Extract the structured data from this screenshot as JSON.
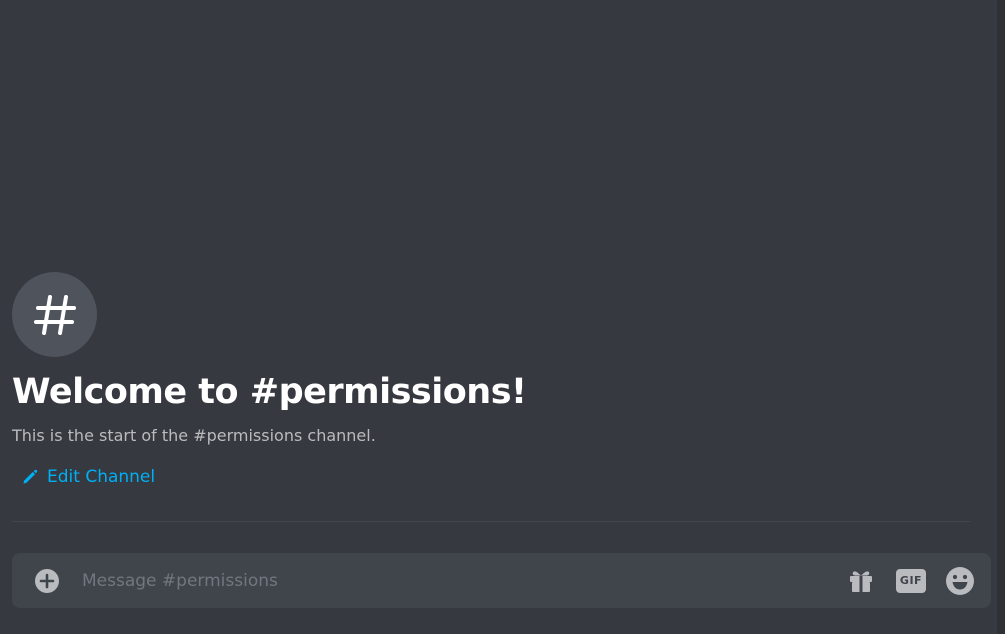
{
  "welcome": {
    "icon": "hashtag-icon",
    "title": "Welcome to #permissions!",
    "subtitle": "This is the start of the #permissions channel.",
    "edit_channel_label": "Edit Channel",
    "edit_icon": "pencil-icon"
  },
  "composer": {
    "placeholder": "Message #permissions",
    "value": "",
    "attach_icon": "plus-circle-icon",
    "gift_icon": "gift-icon",
    "gif_label": "GIF",
    "emoji_icon": "smiley-icon"
  },
  "colors": {
    "background": "#36393f",
    "composer_background": "#40444b",
    "link": "#00b0f4",
    "avatar": "#4f545c"
  }
}
